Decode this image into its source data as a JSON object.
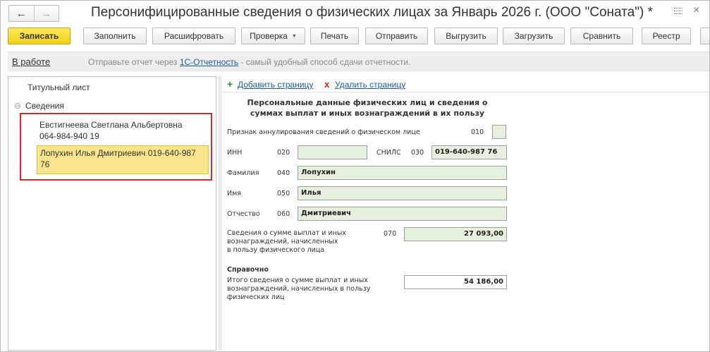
{
  "window": {
    "title": "Персонифицированные сведения о физических лицах за Январь 2026 г. (ООО \"Соната\") *",
    "back_glyph": "←",
    "forward_glyph": "→",
    "close_glyph": "×"
  },
  "toolbar": {
    "save": "Записать",
    "fill": "Заполнить",
    "decode": "Расшифровать",
    "check": "Проверка",
    "check_caret": "▼",
    "print": "Печать",
    "send": "Отправить",
    "export": "Выгрузить",
    "import": "Загрузить",
    "compare": "Сравнить",
    "registry": "Реестр"
  },
  "infobar": {
    "state": "В работе",
    "msg_prefix": "Отправьте отчет через ",
    "msg_link": "1С-Отчетность",
    "msg_suffix": " - самый удобный способ сдачи отчетности."
  },
  "tree": {
    "title_page": "Титульный лист",
    "section": "Сведения",
    "section_toggle": "⊖",
    "persons": [
      {
        "line1": "Евстигнеева Светлана Альбертовна",
        "line2": "064-984-940 19"
      },
      {
        "line1": "Лопухин Илья Дмитриевич 019-640-987",
        "line2": "76"
      }
    ]
  },
  "pages": {
    "add_icon": "+",
    "add": "Добавить страницу",
    "delete_icon": "x",
    "delete": "Удалить страницу"
  },
  "form": {
    "header_line1": "Персональные данные физических лиц и сведения о",
    "header_line2": "суммах выплат и иных вознаграждений в их пользу",
    "annul_label": "Признак аннулирования сведений о физическом лице",
    "annul_code": "010",
    "inn_label": "ИНН",
    "inn_code": "020",
    "inn_value": "",
    "snils_label": "СНИЛС",
    "snils_code": "030",
    "snils_value": "019-640-987 76",
    "surname_label": "Фамилия",
    "surname_code": "040",
    "surname_value": "Лопухин",
    "name_label": "Имя",
    "name_code": "050",
    "name_value": "Илья",
    "patronymic_label": "Отчество",
    "patronymic_code": "060",
    "patronymic_value": "Дмитриевич",
    "payments_label_1": "Сведения о сумме выплат и иных",
    "payments_label_2": "вознаграждений, начисленных",
    "payments_label_3": "в пользу физического лица",
    "payments_code": "070",
    "payments_value": "27 093,00",
    "reference_title": "Справочно",
    "total_label_1": "Итого сведения о сумме выплат и иных",
    "total_label_2": "вознаграждений, начисленных в пользу",
    "total_label_3": "физических лиц",
    "total_value": "54 186,00"
  }
}
